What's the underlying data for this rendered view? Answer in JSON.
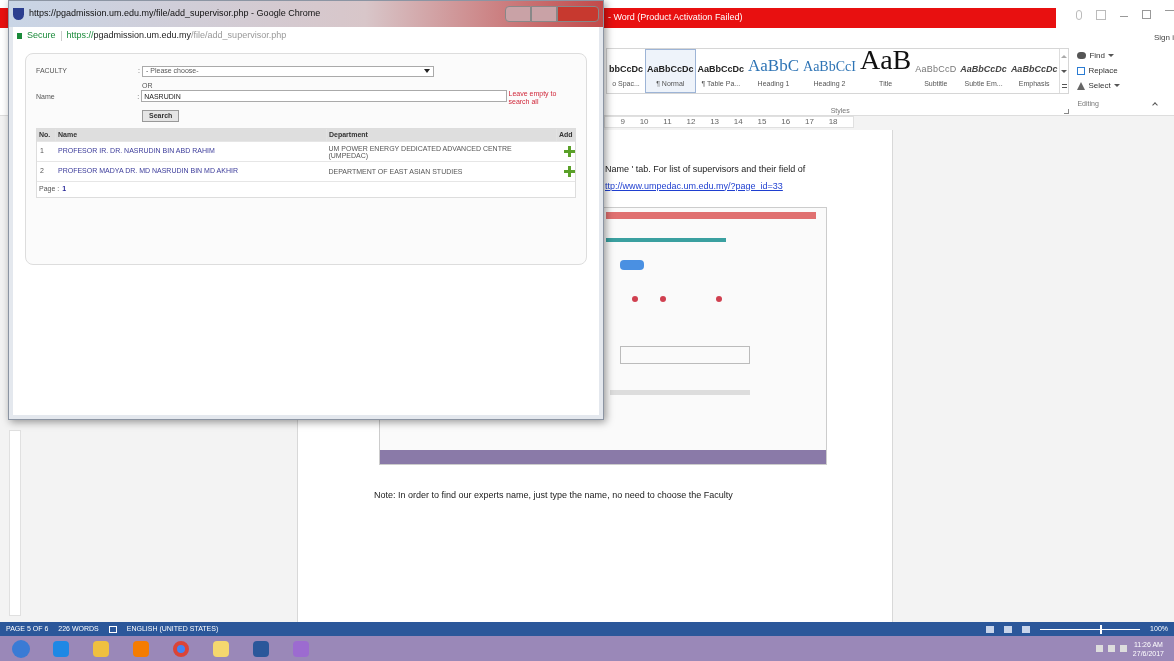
{
  "word": {
    "title": "- Word (Product Activation Failed)",
    "sign_in": "Sign i",
    "styles": [
      {
        "sample": "bbCcDc",
        "name": "o Spac...",
        "kind": "plain",
        "selected": false
      },
      {
        "sample": "AaBbCcDc",
        "name": "¶ Normal",
        "kind": "plain",
        "selected": true
      },
      {
        "sample": "AaBbCcDc",
        "name": "¶ Table Pa...",
        "kind": "plain",
        "selected": false
      },
      {
        "sample": "AaBbC",
        "name": "Heading 1",
        "kind": "heading1",
        "selected": false
      },
      {
        "sample": "AaBbCcI",
        "name": "Heading 2",
        "kind": "heading2",
        "selected": false
      },
      {
        "sample": "AaB",
        "name": "Title",
        "kind": "title",
        "selected": false
      },
      {
        "sample": "AaBbCcD",
        "name": "Subtitle",
        "kind": "subtitle",
        "selected": false
      },
      {
        "sample": "AaBbCcDc",
        "name": "Subtle Em...",
        "kind": "italic",
        "selected": false
      },
      {
        "sample": "AaBbCcDc",
        "name": "Emphasis",
        "kind": "italic",
        "selected": false
      }
    ],
    "styles_label": "Styles",
    "editing": [
      {
        "label": "Find",
        "kind": "find",
        "dropdown": true
      },
      {
        "label": "Replace",
        "kind": "replace",
        "dropdown": false
      },
      {
        "label": "Select",
        "kind": "select",
        "dropdown": true
      }
    ],
    "editing_label": "Editing",
    "ruler": [
      "9",
      "10",
      "11",
      "12",
      "13",
      "14",
      "15",
      "16",
      "17",
      "18"
    ],
    "document": {
      "line_1": "Name ' tab. For list of supervisors and their field of",
      "link": "ttp://www.umpedac.um.edu.my/?page_id=33",
      "note": "Note: In order to find our experts name, just type the name, no need to choose the Faculty"
    },
    "status_bar": {
      "page": "PAGE 5 OF 6",
      "words": "226 WORDS",
      "language": "ENGLISH (UNITED STATES)",
      "zoom": "100%",
      "zoom_slider": {
        "level": 0.6
      }
    }
  },
  "taskbar": {
    "apps": [
      {
        "kind": "start"
      },
      {
        "kind": "ie"
      },
      {
        "kind": "explorer"
      },
      {
        "kind": "media"
      },
      {
        "kind": "chrome"
      },
      {
        "kind": "folder"
      },
      {
        "kind": "word"
      },
      {
        "kind": "paint"
      }
    ],
    "time": "11:26 AM",
    "date": "27/6/2017"
  },
  "popup": {
    "title": "https://pgadmission.um.edu.my/file/add_supervisor.php - Google Chrome",
    "address": {
      "secure": "Secure",
      "scheme": "https://",
      "host": "pgadmission.um.edu.my",
      "path": "/file/add_supervisor.php"
    },
    "form": {
      "faculty_label": "FACULTY",
      "faculty_colon": ":",
      "name_colon": ":",
      "faculty_placeholder": "- Please choose-",
      "or": "OR",
      "name_label": "Name",
      "name_value": "NASRUDIN",
      "hint": "Leave empty to search all",
      "search": "Search"
    },
    "table": {
      "columns": [
        "No.",
        "Name",
        "Department",
        "Add"
      ],
      "rows": [
        {
          "no": "1",
          "name": "PROFESOR IR. DR. NASRUDIN BIN ABD RAHIM",
          "department": "UM POWER ENERGY DEDICATED ADVANCED CENTRE (UMPEDAC)"
        },
        {
          "no": "2",
          "name": "PROFESOR MADYA DR. MD NASRUDIN BIN MD AKHIR",
          "department": "DEPARTMENT OF EAST ASIAN STUDIES"
        }
      ]
    },
    "page_label": "Page :",
    "page": "1"
  }
}
